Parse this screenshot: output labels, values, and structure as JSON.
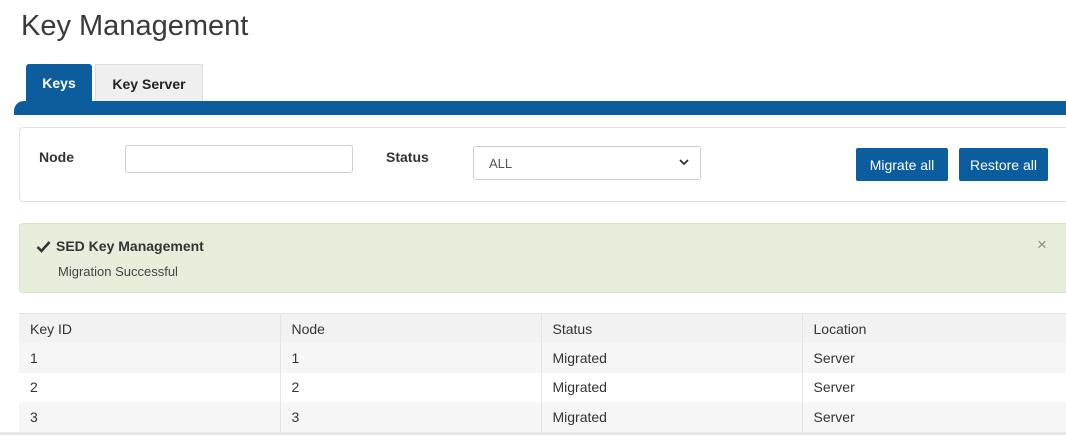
{
  "page": {
    "title": "Key Management"
  },
  "tabs": [
    {
      "label": "Keys",
      "active": true
    },
    {
      "label": "Key Server",
      "active": false
    }
  ],
  "filters": {
    "node_label": "Node",
    "node_value": "",
    "status_label": "Status",
    "status_selected": "ALL",
    "migrate_all_label": "Migrate all",
    "restore_all_label": "Restore all"
  },
  "alert": {
    "title": "SED Key Management",
    "message": "Migration Successful",
    "close_glyph": "×",
    "icon": "check-icon"
  },
  "table": {
    "headers": [
      "Key ID",
      "Node",
      "Status",
      "Location"
    ],
    "rows": [
      [
        "1",
        "1",
        "Migrated",
        "Server"
      ],
      [
        "2",
        "2",
        "Migrated",
        "Server"
      ],
      [
        "3",
        "3",
        "Migrated",
        "Server"
      ]
    ]
  },
  "colors": {
    "brand": "#0b5d9e",
    "alert_bg": "#e6eedb"
  }
}
